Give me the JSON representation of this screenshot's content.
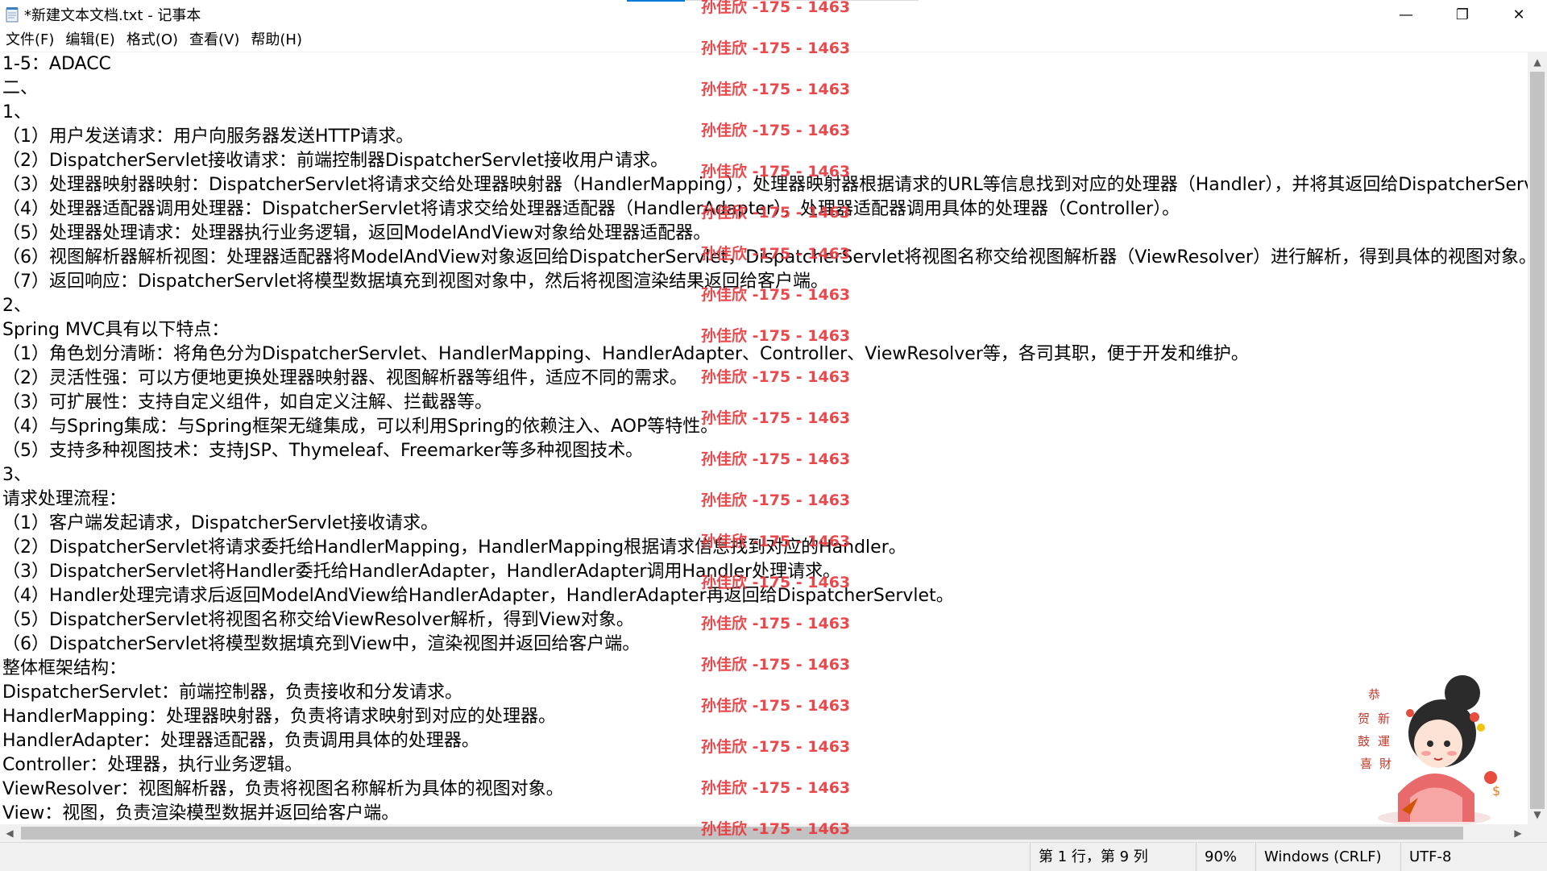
{
  "window": {
    "title": "*新建文本文档.txt - 记事本",
    "minimize": "—",
    "maximize": "❐",
    "close": "✕"
  },
  "menu": [
    "文件(F)",
    "编辑(E)",
    "格式(O)",
    "查看(V)",
    "帮助(H)"
  ],
  "document": {
    "lines": [
      "1-5：ADACC",
      "二、",
      "1、",
      "（1）用户发送请求：用户向服务器发送HTTP请求。",
      "（2）DispatcherServlet接收请求：前端控制器DispatcherServlet接收用户请求。",
      "（3）处理器映射器映射：DispatcherServlet将请求交给处理器映射器（HandlerMapping），处理器映射器根据请求的URL等信息找到对应的处理器（Handler），并将其返回给DispatcherServ",
      "（4）处理器适配器调用处理器：DispatcherServlet将请求交给处理器适配器（HandlerAdapter），处理器适配器调用具体的处理器（Controller）。",
      "（5）处理器处理请求：处理器执行业务逻辑，返回ModelAndView对象给处理器适配器。",
      "（6）视图解析器解析视图：处理器适配器将ModelAndView对象返回给DispatcherServlet，DispatcherServlet将视图名称交给视图解析器（ViewResolver）进行解析，得到具体的视图对象。",
      "（7）返回响应：DispatcherServlet将模型数据填充到视图对象中，然后将视图渲染结果返回给客户端。",
      "2、",
      "Spring MVC具有以下特点：",
      "（1）角色划分清晰：将角色分为DispatcherServlet、HandlerMapping、HandlerAdapter、Controller、ViewResolver等，各司其职，便于开发和维护。",
      "（2）灵活性强：可以方便地更换处理器映射器、视图解析器等组件，适应不同的需求。",
      "（3）可扩展性：支持自定义组件，如自定义注解、拦截器等。",
      "（4）与Spring集成：与Spring框架无缝集成，可以利用Spring的依赖注入、AOP等特性。",
      "（5）支持多种视图技术：支持JSP、Thymeleaf、Freemarker等多种视图技术。",
      "3、",
      "请求处理流程：",
      "（1）客户端发起请求，DispatcherServlet接收请求。",
      "（2）DispatcherServlet将请求委托给HandlerMapping，HandlerMapping根据请求信息找到对应的Handler。",
      "（3）DispatcherServlet将Handler委托给HandlerAdapter，HandlerAdapter调用Handler处理请求。",
      "（4）Handler处理完请求后返回ModelAndView给HandlerAdapter，HandlerAdapter再返回给DispatcherServlet。",
      "（5）DispatcherServlet将视图名称交给ViewResolver解析，得到View对象。",
      "（6）DispatcherServlet将模型数据填充到View中，渲染视图并返回给客户端。",
      "整体框架结构：",
      "DispatcherServlet：前端控制器，负责接收和分发请求。",
      "HandlerMapping：处理器映射器，负责将请求映射到对应的处理器。",
      "HandlerAdapter：处理器适配器，负责调用具体的处理器。",
      "Controller：处理器，执行业务逻辑。",
      "ViewResolver：视图解析器，负责将视图名称解析为具体的视图对象。",
      "View：视图，负责渲染模型数据并返回给客户端。"
    ]
  },
  "watermark": {
    "text": "孙佳欣 -175 - 1463",
    "color": "#e8393e",
    "repeat_count": 21
  },
  "scrollbars": {
    "up": "▲",
    "down": "▼",
    "left": "◀",
    "right": "▶"
  },
  "status": {
    "position": "第 1 行，第 9 列",
    "zoom": "90%",
    "line_ending": "Windows (CRLF)",
    "encoding": "UTF-8"
  }
}
